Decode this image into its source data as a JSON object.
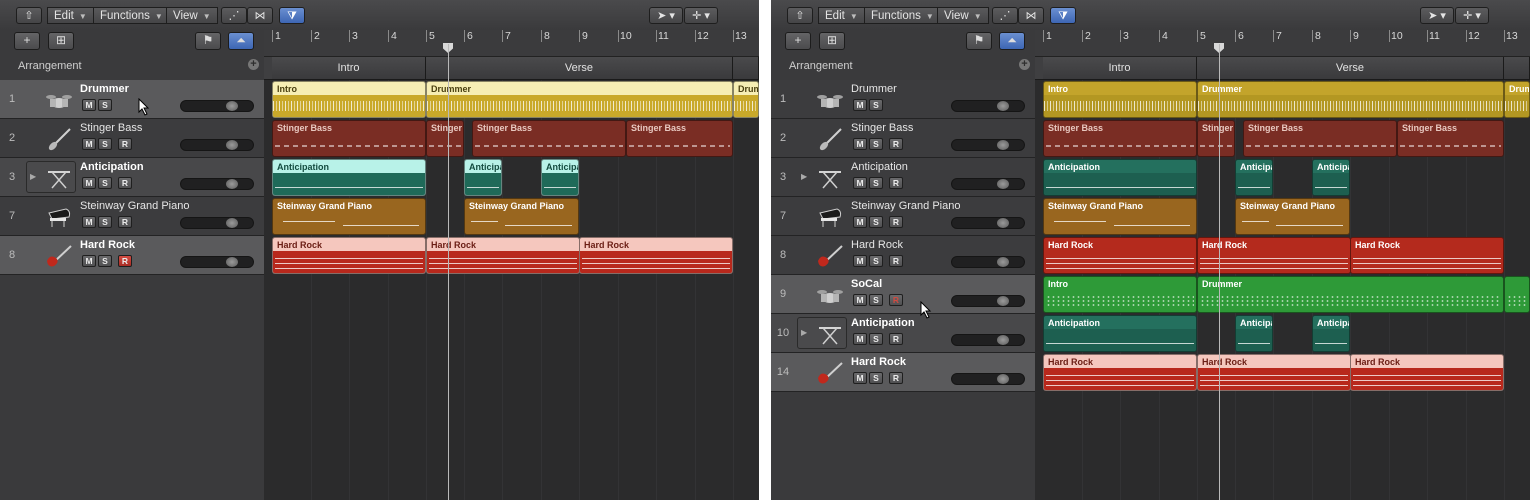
{
  "toolbar": {
    "menus": [
      "Edit",
      "Functions",
      "View"
    ]
  },
  "arrangement": {
    "label": "Arrangement",
    "markers": [
      "Intro",
      "Verse"
    ]
  },
  "ruler": {
    "bars": [
      "1",
      "2",
      "3",
      "4",
      "5",
      "6",
      "7",
      "8",
      "9",
      "10",
      "11",
      "12",
      "13"
    ]
  },
  "left": {
    "tracks": [
      {
        "num": "1",
        "name": "Drummer"
      },
      {
        "num": "2",
        "name": "Stinger Bass"
      },
      {
        "num": "3",
        "name": "Anticipation"
      },
      {
        "num": "7",
        "name": "Steinway Grand Piano"
      },
      {
        "num": "8",
        "name": "Hard Rock"
      }
    ],
    "regions": {
      "drummer": [
        "Intro",
        "Drummer",
        "Drumm"
      ],
      "bass": [
        "Stinger Bass",
        "Stinger",
        "Stinger Bass",
        "Stinger Bass"
      ],
      "anticipation": [
        "Anticipation",
        "Anticipa",
        "Anticipa"
      ],
      "piano": [
        "Steinway Grand Piano",
        "Steinway Grand Piano"
      ],
      "hardrock": [
        "Hard Rock",
        "Hard Rock",
        "Hard Rock"
      ]
    }
  },
  "right": {
    "tracks": [
      {
        "num": "1",
        "name": "Drummer"
      },
      {
        "num": "2",
        "name": "Stinger Bass"
      },
      {
        "num": "3",
        "name": "Anticipation"
      },
      {
        "num": "7",
        "name": "Steinway Grand Piano"
      },
      {
        "num": "8",
        "name": "Hard Rock"
      },
      {
        "num": "9",
        "name": "SoCal"
      },
      {
        "num": "10",
        "name": "Anticipation"
      },
      {
        "num": "14",
        "name": "Hard Rock"
      }
    ],
    "regions": {
      "drummer": [
        "Intro",
        "Drummer",
        "Drum"
      ],
      "bass": [
        "Stinger Bass",
        "Stinger",
        "Stinger Bass",
        "Stinger Bass"
      ],
      "anticipation": [
        "Anticipation",
        "Anticipa",
        "Anticipa"
      ],
      "piano": [
        "Steinway Grand Piano",
        "Steinway Grand Piano"
      ],
      "hardrock": [
        "Hard Rock",
        "Hard Rock",
        "Hard Rock"
      ],
      "socal": [
        "Intro",
        "Drummer"
      ],
      "anticipation2": [
        "Anticipation",
        "Anticipa",
        "Anticipa"
      ],
      "hardrock2": [
        "Hard Rock",
        "Hard Rock",
        "Hard Rock"
      ]
    }
  },
  "buttons": {
    "mute": "M",
    "solo": "S",
    "record": "R"
  },
  "icons": {
    "back": "back-arrow-icon",
    "automation": "automation-icon",
    "flex": "flex-icon",
    "catch": "catch-playhead-icon",
    "pointer": "pointer-tool-icon",
    "marquee": "marquee-tool-icon",
    "add_track": "add-track-icon",
    "folder": "track-folder-icon"
  },
  "colors": {
    "drummer": "#c3a42b",
    "bass": "#7a2d24",
    "anticipation": "#24705e",
    "piano": "#99661f",
    "hardrock": "#b42a1d",
    "socal": "#2e9a38",
    "selected_track": "#5a5a5c"
  }
}
